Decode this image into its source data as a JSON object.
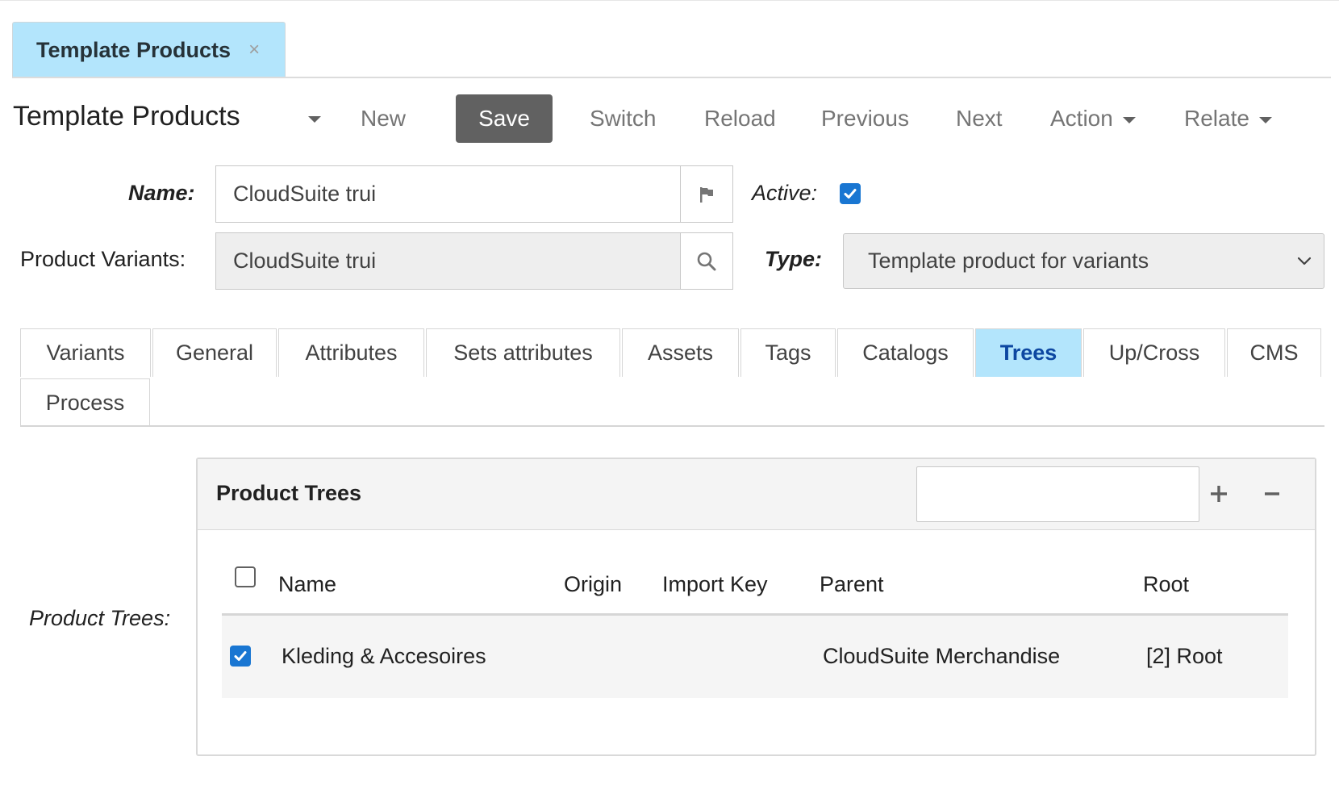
{
  "doc_tab": {
    "label": "Template Products",
    "close": "×"
  },
  "toolbar": {
    "title": "Template Products",
    "new": "New",
    "save": "Save",
    "switch": "Switch",
    "reload": "Reload",
    "previous": "Previous",
    "next": "Next",
    "action": "Action",
    "relate": "Relate"
  },
  "form": {
    "name_label": "Name:",
    "name_value": "CloudSuite trui",
    "active_label": "Active:",
    "active_checked": true,
    "variants_label": "Product Variants:",
    "variants_value": "CloudSuite trui",
    "type_label": "Type:",
    "type_value": "Template product for variants"
  },
  "tabs": [
    {
      "label": "Variants"
    },
    {
      "label": "General"
    },
    {
      "label": "Attributes"
    },
    {
      "label": "Sets attributes"
    },
    {
      "label": "Assets"
    },
    {
      "label": "Tags"
    },
    {
      "label": "Catalogs"
    },
    {
      "label": "Trees",
      "active": true
    },
    {
      "label": "Up/Cross"
    },
    {
      "label": "CMS"
    },
    {
      "label": "Process"
    }
  ],
  "trees": {
    "field_label": "Product Trees:",
    "panel_title": "Product Trees",
    "search_value": "",
    "columns": [
      "Name",
      "Origin",
      "Import Key",
      "Parent",
      "Root"
    ],
    "rows": [
      {
        "checked": true,
        "name": "Kleding & Accesoires",
        "origin": "",
        "import_key": "",
        "parent": "CloudSuite Merchandise",
        "root": "[2] Root"
      }
    ]
  },
  "colors": {
    "accent_tab": "#b3e5fc",
    "save_button": "#616161",
    "checkbox_on": "#1976d2"
  }
}
